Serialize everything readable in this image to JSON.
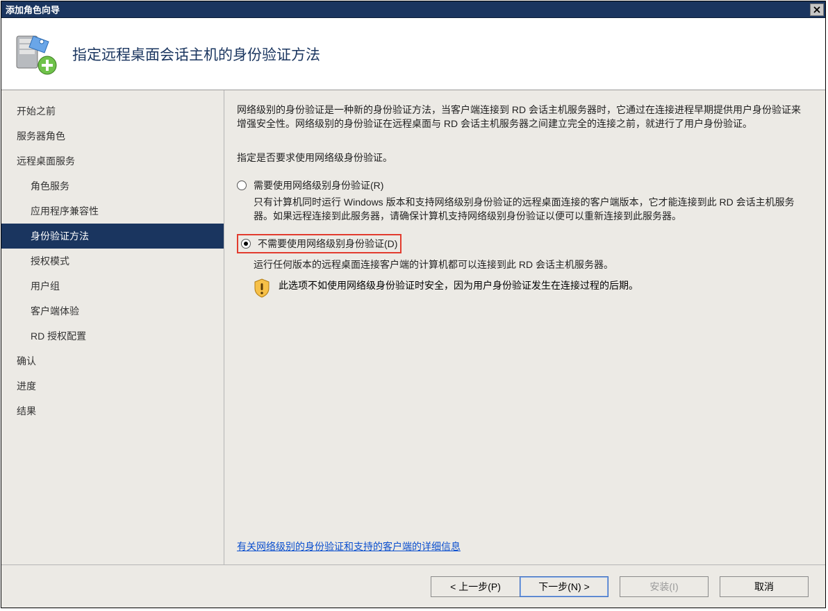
{
  "window": {
    "title": "添加角色向导",
    "close": "✕"
  },
  "header": {
    "title": "指定远程桌面会话主机的身份验证方法"
  },
  "sidebar": {
    "items": [
      {
        "label": "开始之前",
        "indent": 0
      },
      {
        "label": "服务器角色",
        "indent": 0
      },
      {
        "label": "远程桌面服务",
        "indent": 0
      },
      {
        "label": "角色服务",
        "indent": 1
      },
      {
        "label": "应用程序兼容性",
        "indent": 1
      },
      {
        "label": "身份验证方法",
        "indent": 1,
        "selected": true
      },
      {
        "label": "授权模式",
        "indent": 1
      },
      {
        "label": "用户组",
        "indent": 1
      },
      {
        "label": "客户端体验",
        "indent": 1
      },
      {
        "label": "RD 授权配置",
        "indent": 1
      },
      {
        "label": "确认",
        "indent": 0
      },
      {
        "label": "进度",
        "indent": 0
      },
      {
        "label": "结果",
        "indent": 0
      }
    ]
  },
  "content": {
    "description": "网络级别的身份验证是一种新的身份验证方法，当客户端连接到 RD 会话主机服务器时，它通过在连接进程早期提供用户身份验证来增强安全性。网络级别的身份验证在远程桌面与 RD 会话主机服务器之间建立完全的连接之前，就进行了用户身份验证。",
    "prompt": "指定是否要求使用网络级身份验证。",
    "option1": {
      "label": "需要使用网络级别身份验证(R)",
      "desc": "只有计算机同时运行 Windows 版本和支持网络级别身份验证的远程桌面连接的客户端版本，它才能连接到此 RD 会话主机服务器。如果远程连接到此服务器，请确保计算机支持网络级别身份验证以便可以重新连接到此服务器。"
    },
    "option2": {
      "label": "不需要使用网络级别身份验证(D)",
      "desc": "运行任何版本的远程桌面连接客户端的计算机都可以连接到此 RD 会话主机服务器。",
      "warning": "此选项不如使用网络级身份验证时安全，因为用户身份验证发生在连接过程的后期。"
    },
    "link": "有关网络级别的身份验证和支持的客户端的详细信息"
  },
  "footer": {
    "prev": "< 上一步(P)",
    "next": "下一步(N) >",
    "install": "安装(I)",
    "cancel": "取消"
  }
}
